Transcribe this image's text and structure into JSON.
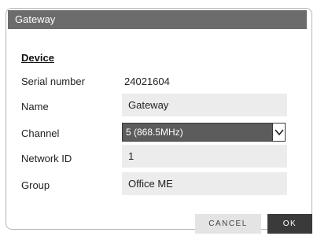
{
  "dialog": {
    "title": "Gateway",
    "section_title": "Device",
    "fields": {
      "serial_number": {
        "label": "Serial number",
        "value": "24021604"
      },
      "name": {
        "label": "Name",
        "value": "Gateway"
      },
      "channel": {
        "label": "Channel",
        "value": "5 (868.5MHz)"
      },
      "network_id": {
        "label": "Network ID",
        "value": "1"
      },
      "group": {
        "label": "Group",
        "value": "Office ME"
      }
    },
    "buttons": {
      "cancel": "CANCEL",
      "ok": "OK"
    }
  },
  "colors": {
    "titlebar": "#6c6c6c",
    "field_bg": "#ececec",
    "select_bg": "#5c5c5c",
    "ok_bg": "#3a3a3a",
    "cancel_bg": "#e4e4e4"
  },
  "icons": {
    "channel_dropdown": "chevron-down-icon"
  }
}
